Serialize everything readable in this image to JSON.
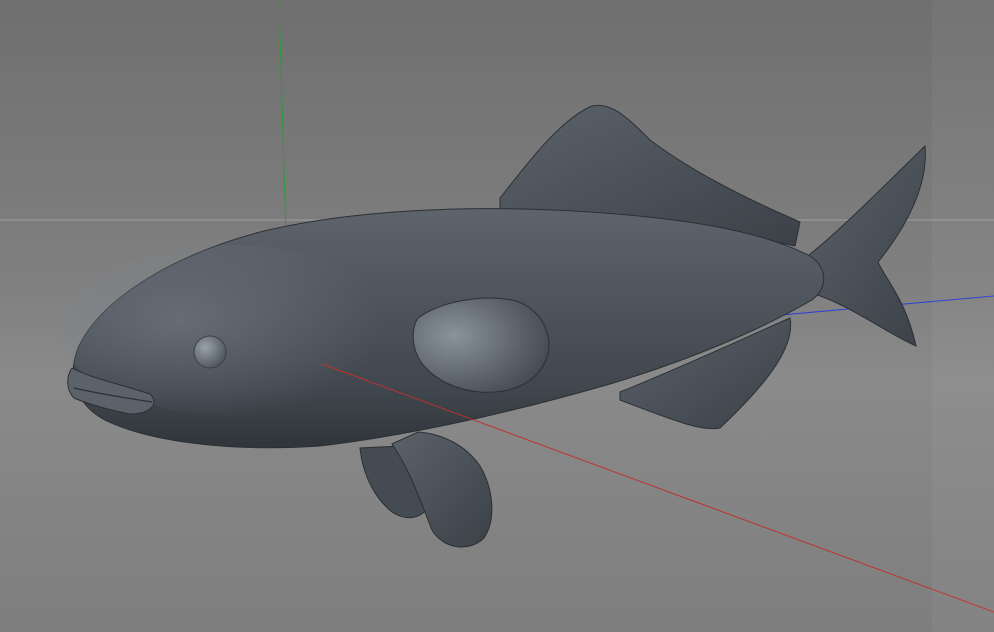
{
  "viewport": {
    "background_top": "#6f6f6f",
    "background_bottom": "#8a8a8a",
    "horizon_color": "#a8a8a8"
  },
  "axes": {
    "x_axis_color": "#c0302c",
    "y_axis_color": "#2f9a3a",
    "z_axis_color": "#2b3ed6"
  },
  "model": {
    "object": "fish",
    "body_color": "#4a5058",
    "highlight_color": "#7d858f",
    "shadow_color": "#2c3136"
  }
}
